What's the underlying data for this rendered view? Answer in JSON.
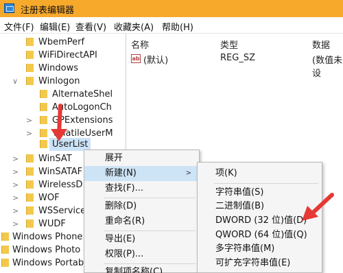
{
  "window": {
    "title": "注册表编辑器"
  },
  "menubar": [
    "文件(F)",
    "编辑(E)",
    "查看(V)",
    "收藏夹(A)",
    "帮助(H)"
  ],
  "tree": {
    "items": [
      "WbemPerf",
      "WiFiDirectAPI",
      "Windows",
      "Winlogon",
      "AlternateShel",
      "AutoLogonCh",
      "GPExtensions",
      "VolatileUserM",
      "UserList",
      "WinSAT",
      "WinSATAF",
      "WirelessD",
      "WOF",
      "WSService",
      "WUDF",
      "Windows Phone",
      "Windows Photo",
      "Windows Portab"
    ]
  },
  "list": {
    "headers": {
      "name": "名称",
      "type": "类型",
      "data": "数据"
    },
    "rows": [
      {
        "name": "(默认)",
        "type": "REG_SZ",
        "data": "(数值未设"
      }
    ]
  },
  "context_menu": {
    "items": [
      "展开",
      "新建(N)",
      "查找(F)...",
      "删除(D)",
      "重命名(R)",
      "导出(E)",
      "权限(P)...",
      "复制项名称(C)"
    ],
    "highlighted": "新建(N)"
  },
  "submenu": {
    "items": [
      "项(K)",
      "字符串值(S)",
      "二进制值(B)",
      "DWORD (32 位)值(D)",
      "QWORD (64 位)值(Q)",
      "多字符串值(M)",
      "可扩充字符串值(E)"
    ]
  },
  "colors": {
    "titlebar": "#f7a92c",
    "highlight": "#cde4f7",
    "annotation_arrow": "#e53935",
    "folder": "#f2c94c"
  }
}
